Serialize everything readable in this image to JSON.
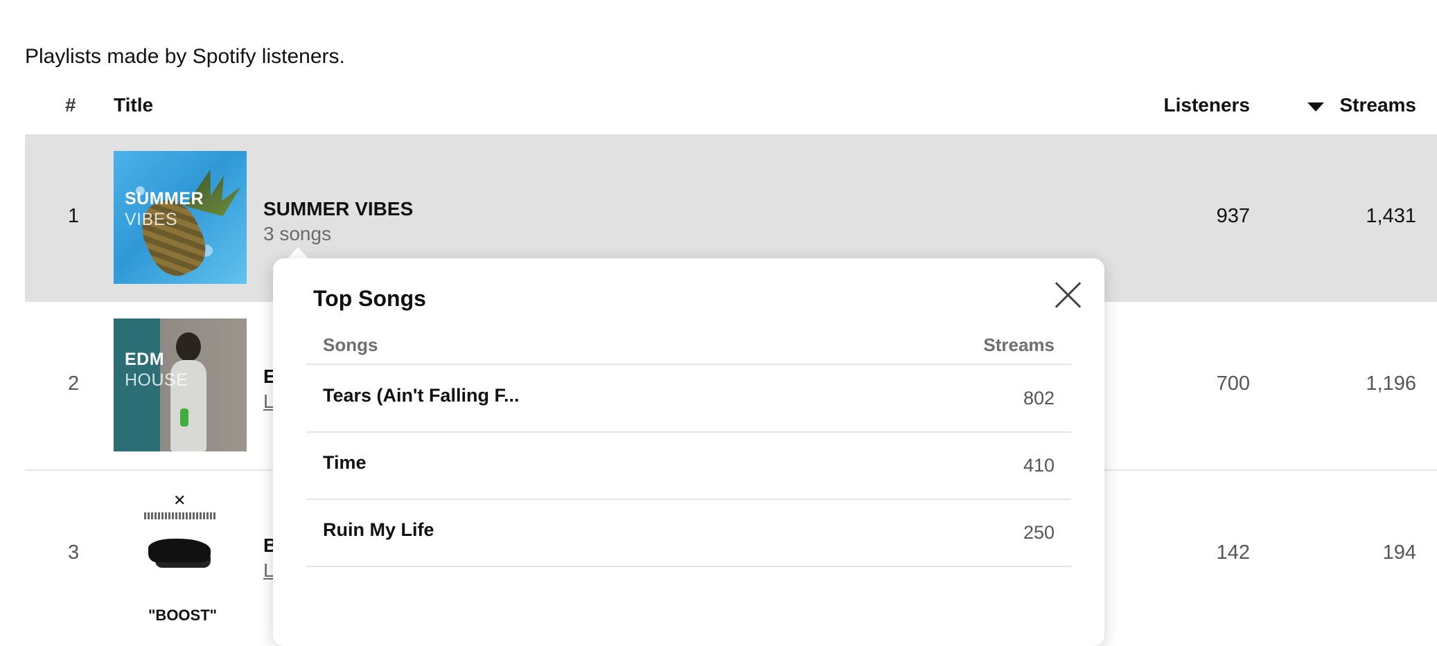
{
  "intro": "Playlists made by Spotify listeners.",
  "table": {
    "headers": {
      "num": "#",
      "title": "Title",
      "listeners": "Listeners",
      "streams": "Streams"
    },
    "rows": [
      {
        "rank": "1",
        "title": "SUMMER VIBES",
        "subtitle": "3 songs",
        "listeners": "937",
        "streams": "1,431",
        "cover_line1": "SUMMER",
        "cover_line2": "VIBES"
      },
      {
        "rank": "2",
        "title": "E",
        "subtitle": "L",
        "listeners": "700",
        "streams": "1,196",
        "cover_line1": "EDM",
        "cover_line2": "HOUSE"
      },
      {
        "rank": "3",
        "title": "B",
        "subtitle": "L",
        "listeners": "142",
        "streams": "194",
        "cover_line1": "\"BOOST\""
      }
    ]
  },
  "popover": {
    "title": "Top Songs",
    "col_songs": "Songs",
    "col_streams": "Streams",
    "songs": [
      {
        "name": "Tears (Ain't Falling F...",
        "streams": "802"
      },
      {
        "name": "Time",
        "streams": "410"
      },
      {
        "name": "Ruin My Life",
        "streams": "250"
      }
    ]
  }
}
